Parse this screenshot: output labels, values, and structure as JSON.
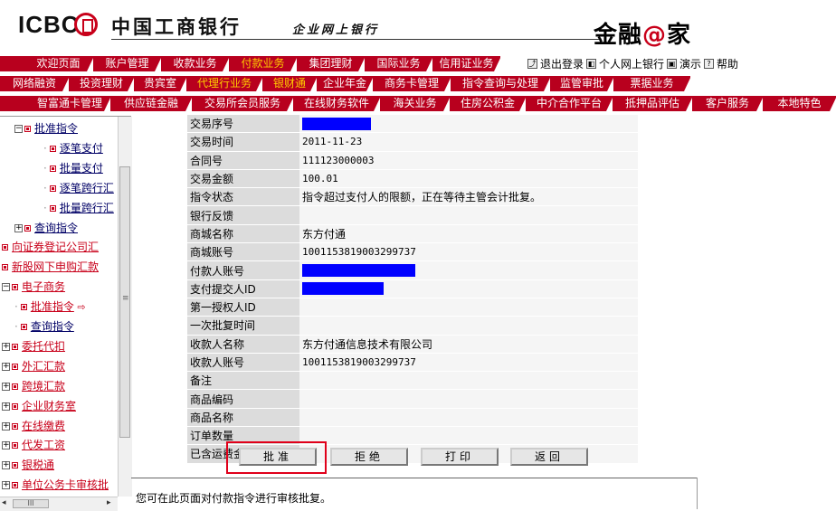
{
  "header": {
    "logo_text": "ICBC",
    "bank_name": "中国工商银行",
    "subtitle": "企业网上银行",
    "brand_prefix": "金融",
    "brand_at": "@",
    "brand_suffix": "家"
  },
  "top_links": {
    "logout": "退出登录",
    "personal": "个人网上银行",
    "demo": "演示",
    "help": "帮助"
  },
  "nav_row1": [
    "欢迎页面",
    "账户管理",
    "收款业务",
    "付款业务",
    "集团理财",
    "国际业务",
    "信用证业务"
  ],
  "nav_row1_active": "付款业务",
  "nav_row2": [
    "网络融资",
    "投资理财",
    "贵宾室",
    "代理行业务",
    "银财通",
    "企业年金",
    "商务卡管理",
    "指令查询与处理",
    "监管审批",
    "票据业务"
  ],
  "nav_row3": [
    "智富通卡管理",
    "供应链金融",
    "交易所会员服务",
    "在线财务软件",
    "海关业务",
    "住房公积金",
    "中介合作平台",
    "抵押品评估",
    "客户服务",
    "本地特色"
  ],
  "tree": [
    {
      "label": "批准指令",
      "level": 1,
      "type": "folder-open"
    },
    {
      "label": "逐笔支付",
      "level": 2
    },
    {
      "label": "批量支付",
      "level": 2
    },
    {
      "label": "逐笔跨行汇",
      "level": 2
    },
    {
      "label": "批量跨行汇",
      "level": 2
    },
    {
      "label": "查询指令",
      "level": 1,
      "type": "folder"
    },
    {
      "label": "向证券登记公司汇",
      "level": 0
    },
    {
      "label": "新股网下申购汇款",
      "level": 0
    },
    {
      "label": "电子商务",
      "level": 0,
      "type": "folder-open"
    },
    {
      "label": "批准指令",
      "level": 1,
      "selected": true
    },
    {
      "label": "查询指令",
      "level": 1
    },
    {
      "label": "委托代扣",
      "level": 0,
      "type": "folder"
    },
    {
      "label": "外汇汇款",
      "level": 0,
      "type": "folder"
    },
    {
      "label": "跨境汇款",
      "level": 0,
      "type": "folder"
    },
    {
      "label": "企业财务室",
      "level": 0,
      "type": "folder"
    },
    {
      "label": "在线缴费",
      "level": 0,
      "type": "folder"
    },
    {
      "label": "代发工资",
      "level": 0,
      "type": "folder"
    },
    {
      "label": "银税通",
      "level": 0,
      "type": "folder"
    },
    {
      "label": "单位公务卡审核批",
      "level": 0,
      "type": "folder"
    }
  ],
  "detail": [
    {
      "label": "交易序号",
      "value": "",
      "redacted": 0.56
    },
    {
      "label": "交易时间",
      "value": "2011-11-23"
    },
    {
      "label": "合同号",
      "value": "111123000003"
    },
    {
      "label": "交易金额",
      "value": "100.01"
    },
    {
      "label": "指令状态",
      "value": "指令超过支付人的限额，正在等待主管会计批复。",
      "cn": true
    },
    {
      "label": "银行反馈",
      "value": ""
    },
    {
      "label": "商城名称",
      "value": "东方付通",
      "cn": true
    },
    {
      "label": "商城账号",
      "value": "1001153819003299737"
    },
    {
      "label": "付款人账号",
      "value": "",
      "redacted": 0.92
    },
    {
      "label": "支付提交人ID",
      "value": "",
      "redacted": 0.66
    },
    {
      "label": "第一授权人ID",
      "value": ""
    },
    {
      "label": "一次批复时间",
      "value": ""
    },
    {
      "label": "收款人名称",
      "value": "东方付通信息技术有限公司",
      "cn": true
    },
    {
      "label": "收款人账号",
      "value": "1001153819003299737"
    },
    {
      "label": "备注",
      "value": ""
    },
    {
      "label": "商品编码",
      "value": ""
    },
    {
      "label": "商品名称",
      "value": ""
    },
    {
      "label": "订单数量",
      "value": ""
    },
    {
      "label": "已含运费金额",
      "value": ""
    }
  ],
  "buttons": {
    "approve": "批准",
    "reject": "拒绝",
    "print": "打印",
    "back": "返回"
  },
  "status_text": "您可在此页面对付款指令进行审核批复。",
  "colors": {
    "nav_red": "#b8001e",
    "active_tab": "#ffcc00",
    "highlight": "#e0001a",
    "redact": "#0000ff"
  }
}
